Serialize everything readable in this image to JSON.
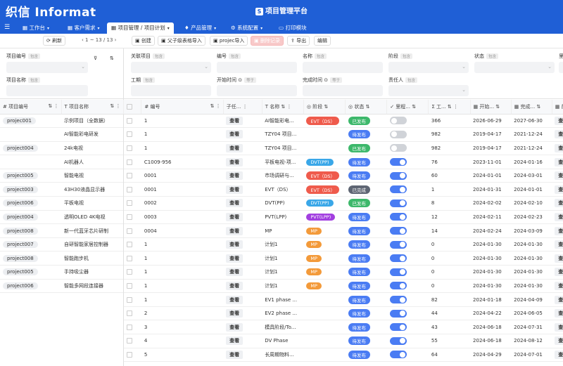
{
  "app": {
    "logo": "织信 Informat",
    "title": "项目管理平台",
    "menu_icon": "menu-icon"
  },
  "tabs": [
    {
      "label": "工作台",
      "caret": "▾"
    },
    {
      "label": "客户需求",
      "caret": "▾"
    },
    {
      "label": "项目管理 / 项目计划",
      "caret": "▾"
    },
    {
      "label": "产品管理",
      "caret": "▾"
    },
    {
      "label": "系统配置",
      "caret": "▾"
    },
    {
      "label": "打印模块",
      "caret": ""
    }
  ],
  "leftbar": {
    "refresh": "刷新",
    "pager": "‹  1 ~ 13 / 13  ›"
  },
  "toolbar": {
    "create": "创建",
    "import_parent": "父子级表格导入",
    "import_projec": "projec导入",
    "delete": "删除记录",
    "export": "导出",
    "edit": "编辑"
  },
  "filters": {
    "tag": "包含",
    "tag_eq": "等于",
    "left": [
      {
        "label": "项目编号"
      },
      {
        "label": "项目名称"
      }
    ],
    "right": [
      {
        "label": "关联项目"
      },
      {
        "label": "编号"
      },
      {
        "label": "名称"
      },
      {
        "label": "阶段"
      },
      {
        "label": "状态"
      },
      {
        "label": "里"
      },
      {
        "label": "工期"
      },
      {
        "label": "开始时间"
      },
      {
        "label": "完成时间"
      },
      {
        "label": "责任人"
      }
    ]
  },
  "left_table": {
    "headers": [
      "# 项目编号",
      "T 项目名称"
    ],
    "rows": [
      {
        "code": "projec001",
        "name": "示例项目（全数据）"
      },
      {
        "code": "",
        "name": "AI智能彩电研发"
      },
      {
        "code": "project004",
        "name": "24k电视"
      },
      {
        "code": "",
        "name": "AI机器人"
      },
      {
        "code": "project005",
        "name": "智能电视"
      },
      {
        "code": "project003",
        "name": "43H30液晶显示器"
      },
      {
        "code": "project006",
        "name": "平板电视"
      },
      {
        "code": "project004",
        "name": "透明OLED 4K电视"
      },
      {
        "code": "project008",
        "name": "新一代蓝牙芯片研制"
      },
      {
        "code": "project007",
        "name": "自研智能家居控制器"
      },
      {
        "code": "project008",
        "name": "智能跑步机"
      },
      {
        "code": "project005",
        "name": "手持吸尘器"
      },
      {
        "code": "project006",
        "name": "智能多网段连接器"
      }
    ]
  },
  "main_table": {
    "headers": [
      "# 编号",
      "子任...",
      "T 名称",
      "阶段",
      "状态",
      "里程...",
      "Σ 工...",
      "开始...",
      "完成...",
      "前"
    ],
    "view_label": "查看",
    "colors": {
      "EVT": "#ef5b4c",
      "DVT": "#3aa7e8",
      "PVT": "#a23fe0",
      "MP": "#f39a3a",
      "已发布": "#3db86b",
      "待发布": "#4a7cf3",
      "已完成": "#5e6573"
    },
    "rows": [
      {
        "num": "1",
        "sub": "查看",
        "name": "AI智能彩电...",
        "phase": "EVT（DS）",
        "phase_key": "EVT",
        "status": "已发布",
        "toggle": false,
        "work": "366",
        "start": "2026-06-29",
        "end": "2027-06-30"
      },
      {
        "num": "1",
        "sub": "查看",
        "name": "TZY04 项目...",
        "phase": "",
        "phase_key": "",
        "status": "待发布",
        "toggle": false,
        "work": "982",
        "start": "2019-04-17",
        "end": "2021-12-24"
      },
      {
        "num": "1",
        "sub": "查看",
        "name": "TZY04 项目...",
        "phase": "",
        "phase_key": "",
        "status": "已发布",
        "toggle": false,
        "work": "982",
        "start": "2019-04-17",
        "end": "2021-12-24"
      },
      {
        "num": "C1009-956",
        "sub": "查看",
        "name": "平板电视-项...",
        "phase": "DVT(PP)",
        "phase_key": "DVT",
        "status": "待发布",
        "toggle": true,
        "work": "76",
        "start": "2023-11-01",
        "end": "2024-01-16"
      },
      {
        "num": "0001",
        "sub": "查看",
        "name": "市场调研与...",
        "phase": "EVT（DS）",
        "phase_key": "EVT",
        "status": "待发布",
        "toggle": true,
        "work": "60",
        "start": "2024-01-01",
        "end": "2024-03-01"
      },
      {
        "num": "0001",
        "sub": "查看",
        "name": "EVT（DS）",
        "phase": "EVT（DS）",
        "phase_key": "EVT",
        "status": "已完成",
        "toggle": true,
        "work": "1",
        "start": "2024-01-31",
        "end": "2024-01-01"
      },
      {
        "num": "0002",
        "sub": "查看",
        "name": "DVT(PP)",
        "phase": "DVT(PP)",
        "phase_key": "DVT",
        "status": "已发布",
        "toggle": true,
        "work": "8",
        "start": "2024-02-02",
        "end": "2024-02-10"
      },
      {
        "num": "0003",
        "sub": "查看",
        "name": "PVT(LPP)",
        "phase": "PVT(LPP)",
        "phase_key": "PVT",
        "status": "待发布",
        "toggle": true,
        "work": "12",
        "start": "2024-02-11",
        "end": "2024-02-23"
      },
      {
        "num": "0004",
        "sub": "查看",
        "name": "MP",
        "phase": "MP",
        "phase_key": "MP",
        "status": "待发布",
        "toggle": true,
        "work": "14",
        "start": "2024-02-24",
        "end": "2024-03-09"
      },
      {
        "num": "1",
        "sub": "查看",
        "name": "计划1",
        "phase": "MP",
        "phase_key": "MP",
        "status": "待发布",
        "toggle": true,
        "work": "0",
        "start": "2024-01-30",
        "end": "2024-01-30"
      },
      {
        "num": "1",
        "sub": "查看",
        "name": "计划1",
        "phase": "MP",
        "phase_key": "MP",
        "status": "待发布",
        "toggle": true,
        "work": "0",
        "start": "2024-01-30",
        "end": "2024-01-30"
      },
      {
        "num": "1",
        "sub": "查看",
        "name": "计划1",
        "phase": "MP",
        "phase_key": "MP",
        "status": "待发布",
        "toggle": true,
        "work": "0",
        "start": "2024-01-30",
        "end": "2024-01-30"
      },
      {
        "num": "1",
        "sub": "查看",
        "name": "计划1",
        "phase": "MP",
        "phase_key": "MP",
        "status": "待发布",
        "toggle": true,
        "work": "0",
        "start": "2024-01-30",
        "end": "2024-01-30"
      },
      {
        "num": "1",
        "sub": "查看",
        "name": "EV1 phase ...",
        "phase": "",
        "phase_key": "",
        "status": "待发布",
        "toggle": true,
        "work": "82",
        "start": "2024-01-18",
        "end": "2024-04-09"
      },
      {
        "num": "2",
        "sub": "查看",
        "name": "EV2 phase ...",
        "phase": "",
        "phase_key": "",
        "status": "待发布",
        "toggle": true,
        "work": "44",
        "start": "2024-04-22",
        "end": "2024-06-05"
      },
      {
        "num": "3",
        "sub": "查看",
        "name": "模具阶段/To...",
        "phase": "",
        "phase_key": "",
        "status": "待发布",
        "toggle": true,
        "work": "43",
        "start": "2024-06-18",
        "end": "2024-07-31"
      },
      {
        "num": "4",
        "sub": "查看",
        "name": "DV Phase",
        "phase": "",
        "phase_key": "",
        "status": "待发布",
        "toggle": true,
        "work": "55",
        "start": "2024-06-18",
        "end": "2024-08-12"
      },
      {
        "num": "5",
        "sub": "查看",
        "name": "长周期物料...",
        "phase": "",
        "phase_key": "",
        "status": "待发布",
        "toggle": true,
        "work": "64",
        "start": "2024-04-29",
        "end": "2024-07-01"
      }
    ]
  }
}
